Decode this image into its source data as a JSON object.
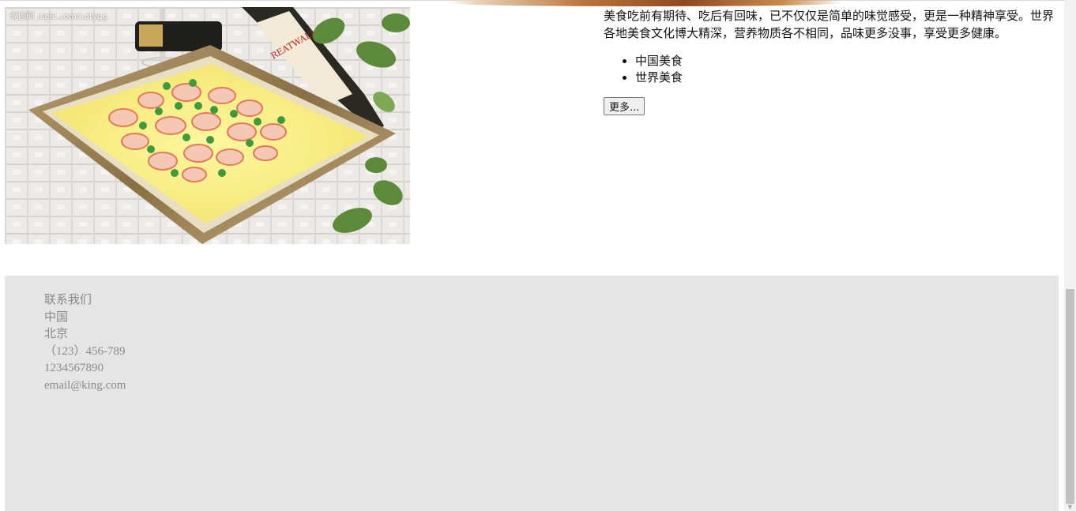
{
  "image": {
    "watermark": "昵图网 nipic.com/xatygg",
    "icon": "shrimp-dish-photo"
  },
  "content": {
    "paragraph": "美食吃前有期待、吃后有回味，已不仅仅是简单的味觉感受，更是一种精神享受。世界各地美食文化博大精深，营养物质各不相同，品味更多没事，享受更多健康。",
    "list": [
      "中国美食",
      "世界美食"
    ],
    "more_label": "更多..."
  },
  "footer": {
    "lines": [
      "联系我们",
      "中国",
      "北京",
      "（123）456-789",
      "1234567890",
      "email@king.com"
    ]
  },
  "colors": {
    "footer_bg": "#e5e5e5",
    "footer_text": "#8a8a8a"
  }
}
